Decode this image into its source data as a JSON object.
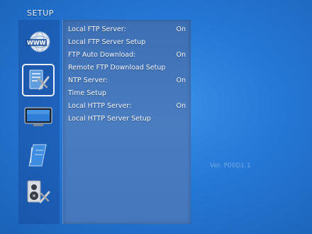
{
  "header": {
    "title": "SETUP"
  },
  "menu": {
    "items": [
      {
        "label": "Local FTP Server:",
        "value": "On"
      },
      {
        "label": "Local FTP Server Setup",
        "value": ""
      },
      {
        "label": "FTP Auto Download:",
        "value": "On"
      },
      {
        "label": "Remote FTP Download Setup",
        "value": ""
      },
      {
        "label": "NTP Server:",
        "value": "On"
      },
      {
        "label": "Time Setup",
        "value": ""
      },
      {
        "label": "Local HTTP Server:",
        "value": "On"
      },
      {
        "label": "Local HTTP Server Setup",
        "value": ""
      }
    ]
  },
  "nav": {
    "icons": [
      "www-network-icon",
      "settings-tools-icon",
      "tv-display-icon",
      "notebook-icon",
      "speaker-audio-icon"
    ],
    "selected": "settings-tools-icon"
  },
  "footer": {
    "version": "Ver. P00D1.1"
  },
  "colors": {
    "background": "#2578d6",
    "panel": "#4577bd",
    "text": "#f4f7ff"
  }
}
